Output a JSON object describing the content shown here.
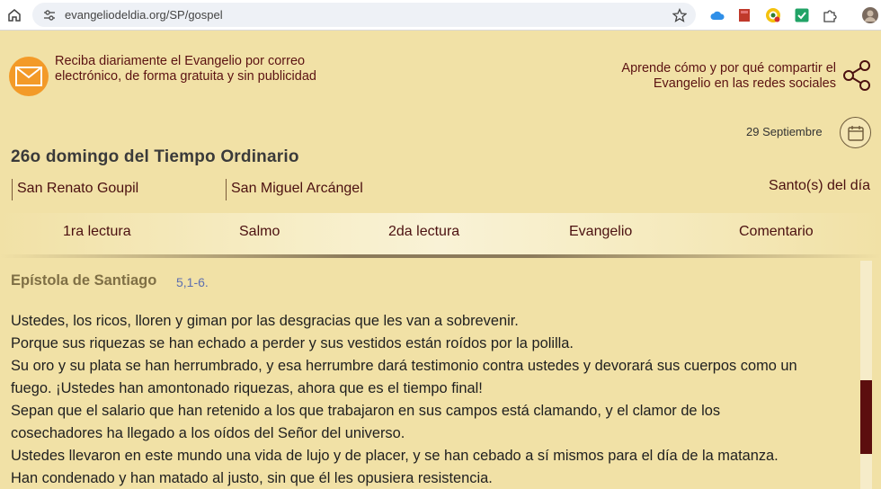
{
  "browser": {
    "url": "evangeliodeldia.org/SP/gospel",
    "icons": [
      "home-icon",
      "site-settings-icon",
      "bookmark-star-icon",
      "cloud-extension-icon",
      "book-extension-icon",
      "lock-extension-icon",
      "check-extension-icon",
      "puzzle-extension-icon",
      "profile-avatar"
    ]
  },
  "header": {
    "mail_text": "Reciba diariamente el Evangelio por correo electrónico, de forma gratuita y sin publicidad",
    "share_text": "Aprende cómo y por qué compartir el Evangelio en las redes sociales"
  },
  "date": {
    "label": "29 Septiembre"
  },
  "day": {
    "title": "26o domingo del Tiempo Ordinario",
    "saints": [
      "San Renato Goupil",
      "San Miguel Arcángel"
    ],
    "saints_label": "Santo(s) del día"
  },
  "tabs": [
    "1ra lectura",
    "Salmo",
    "2da lectura",
    "Evangelio",
    "Comentario"
  ],
  "reading": {
    "title": "Epístola de Santiago",
    "reference": "5,1-6.",
    "lines": [
      "Ustedes, los ricos, lloren y giman por las desgracias que les van a sobrevenir.",
      "Porque sus riquezas se han echado a perder y sus vestidos están roídos por la polilla.",
      "Su oro y su plata se han herrumbrado, y esa herrumbre dará testimonio contra ustedes y devorará sus cuerpos como un",
      "fuego. ¡Ustedes han amontonado riquezas, ahora que es el tiempo final!",
      "Sepan que el salario que han retenido a los que trabajaron en sus campos está clamando, y el clamor de los",
      "cosechadores ha llegado a los oídos del Señor del universo.",
      "Ustedes llevaron en este mundo una vida de lujo y de placer, y se han cebado a sí mismos para el día de la matanza.",
      "Han condenado y han matado al justo, sin que él les opusiera resistencia."
    ]
  },
  "colors": {
    "page_bg": "#f1e1a6",
    "accent": "#5b1212",
    "mail_orange": "#f39a28",
    "scroll_thumb": "#5c0e0e"
  }
}
